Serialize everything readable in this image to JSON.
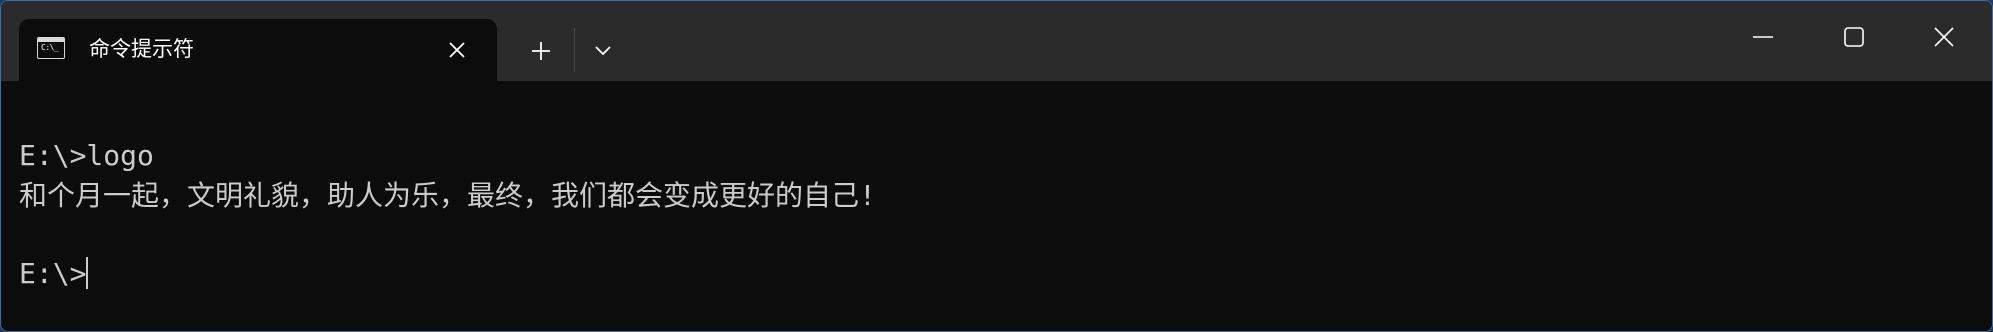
{
  "tab": {
    "icon": "command-prompt-icon",
    "title": "命令提示符",
    "close_icon": "close-icon"
  },
  "titlebar": {
    "new_tab_icon": "plus-icon",
    "dropdown_icon": "chevron-down-icon",
    "minimize_icon": "minimize-icon",
    "maximize_icon": "maximize-icon",
    "close_icon": "close-icon"
  },
  "terminal": {
    "lines": [
      "E:\\>logo",
      "和个月一起，文明礼貌，助人为乐，最终，我们都会变成更好的自己!",
      "",
      "E:\\>"
    ]
  },
  "colors": {
    "terminal_bg": "#0c0c0c",
    "titlebar_bg": "#2b2b2b",
    "text": "#cccccc",
    "window_border": "#3a6ea8"
  }
}
